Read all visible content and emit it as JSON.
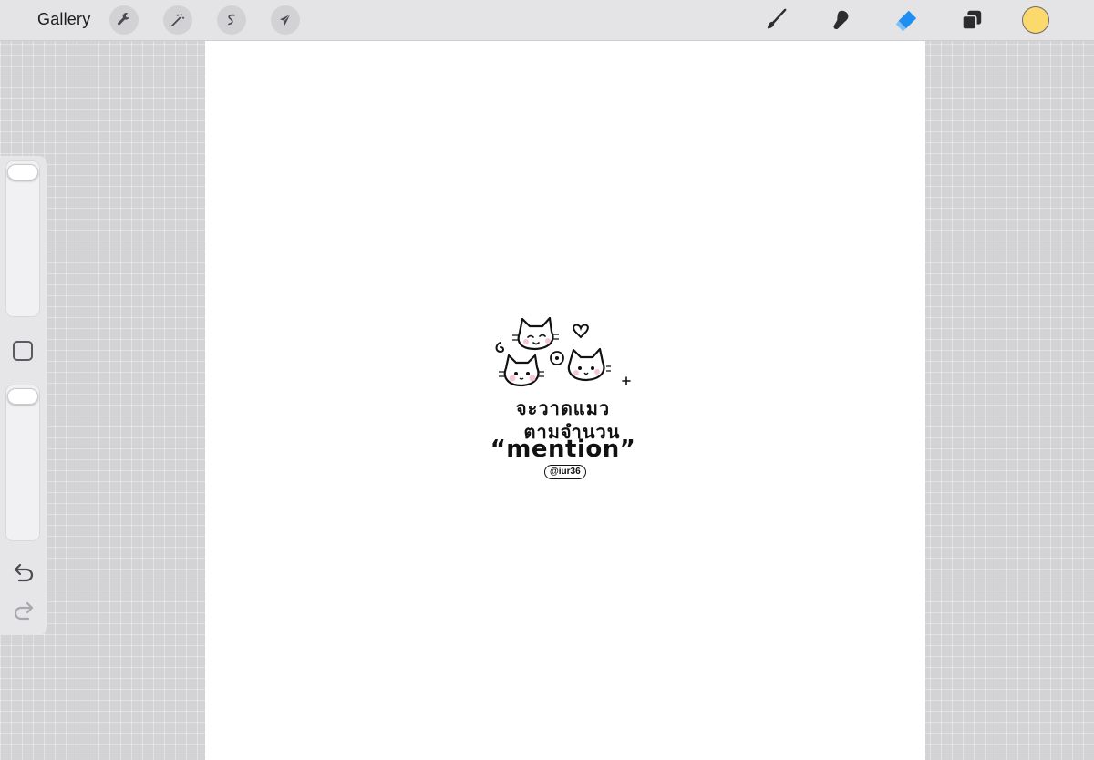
{
  "toolbar": {
    "gallery_label": "Gallery",
    "left_tools": [
      {
        "name": "actions",
        "icon": "wrench-icon"
      },
      {
        "name": "adjustments",
        "icon": "magic-wand-icon"
      },
      {
        "name": "selection",
        "icon": "selection-s-icon"
      },
      {
        "name": "transform",
        "icon": "arrow-cursor-icon"
      }
    ],
    "right_tools": [
      {
        "name": "paint",
        "icon": "brush-icon",
        "active": false
      },
      {
        "name": "smudge",
        "icon": "smudge-icon",
        "active": false
      },
      {
        "name": "erase",
        "icon": "eraser-icon",
        "active": true
      },
      {
        "name": "layers",
        "icon": "layers-icon",
        "active": false
      }
    ],
    "current_color": "#FCD96D",
    "active_tool_color": "#1E8EF0"
  },
  "sidebar": {
    "brush_size_level": 0.0,
    "brush_opacity_level": 0.0,
    "modify_icon": "square-icon",
    "undo_icon": "undo-icon",
    "redo_icon": "redo-icon"
  },
  "artwork": {
    "line1": "จะวาดแมว",
    "line2": "ตามจำนวน",
    "line3": "“mention”",
    "handle": "@iur36"
  }
}
